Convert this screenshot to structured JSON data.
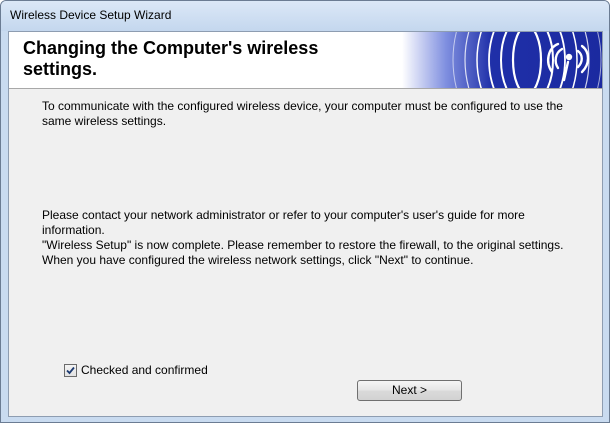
{
  "window": {
    "title": "Wireless Device Setup Wizard"
  },
  "header": {
    "heading": "Changing the Computer's wireless settings.",
    "banner_icon": "wireless-signal-icon",
    "banner_color": "#1f2fa8"
  },
  "content": {
    "paragraph1": "To communicate with the configured wireless device, your computer must be configured to use the same wireless settings.",
    "paragraph2_line1": "Please contact your network administrator or refer to your computer's user's guide for more information.",
    "paragraph2_line2": "\"Wireless Setup\" is now complete. Please remember to restore the firewall, to the original settings. When you have configured the wireless network settings, click \"Next\" to continue."
  },
  "confirm": {
    "label": "Checked and confirmed",
    "checked": true
  },
  "buttons": {
    "next_label": "Next >"
  }
}
